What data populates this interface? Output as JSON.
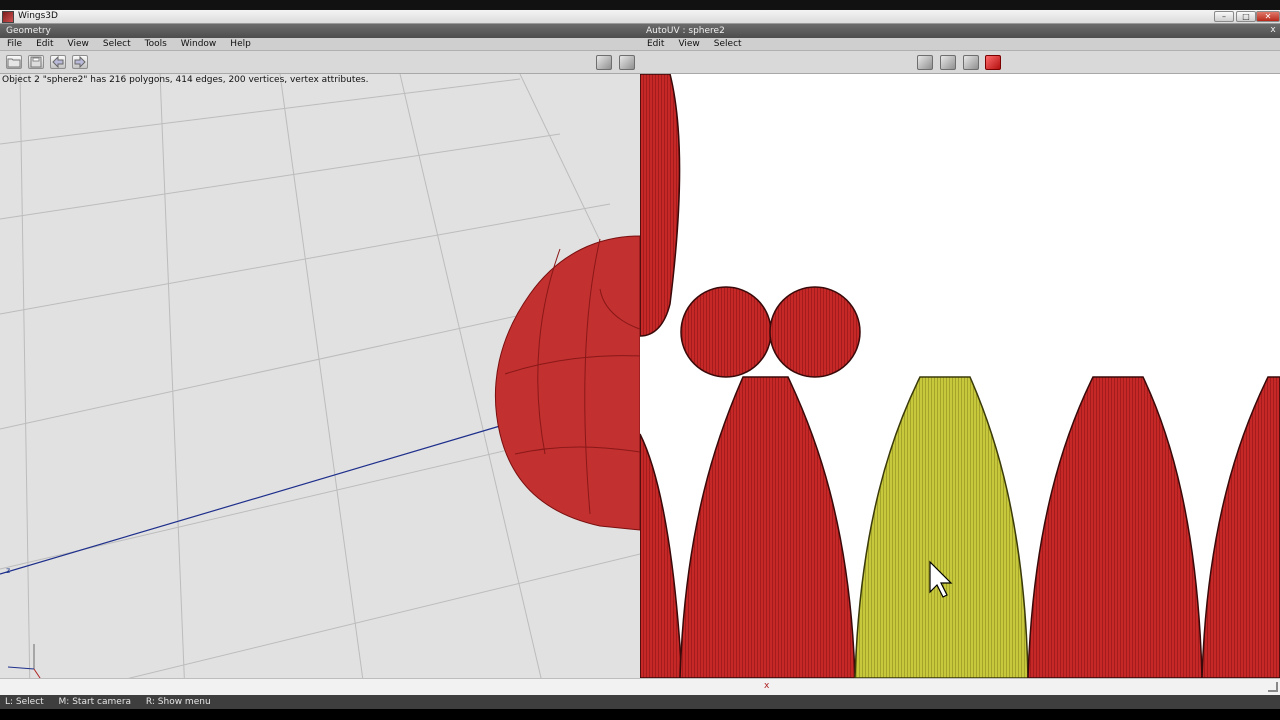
{
  "app": {
    "title": "Wings3D"
  },
  "window_buttons": {
    "minimize": "–",
    "maximize": "□",
    "close": "✕"
  },
  "geometry": {
    "title": "Geometry",
    "menu": [
      "File",
      "Edit",
      "View",
      "Select",
      "Tools",
      "Window",
      "Help"
    ],
    "info": "Object 2 \"sphere2\" has 216 polygons, 414 edges, 200 vertices, vertex attributes.",
    "axis_z": "z"
  },
  "autouv": {
    "title": "AutoUV : sphere2",
    "menu": [
      "Edit",
      "View",
      "Select"
    ],
    "close": "x",
    "axis_x": "x"
  },
  "status": {
    "items": [
      "L: Select",
      "M: Start camera",
      "R: Show menu"
    ]
  },
  "colors": {
    "mesh_red": "#c62828",
    "selected_yellow": "#c8c83c",
    "viewport_bg": "#e1e1e1",
    "uv_bg": "#ffffff",
    "axis_blue": "#1e2f8c"
  },
  "icons": {
    "open": "folder-icon",
    "save": "save-icon",
    "undo": "arrow-left-icon",
    "redo": "arrow-right-icon",
    "selection_modes": [
      "vertex-mode-icon",
      "edge-mode-icon",
      "face-mode-icon",
      "body-mode-icon"
    ]
  }
}
